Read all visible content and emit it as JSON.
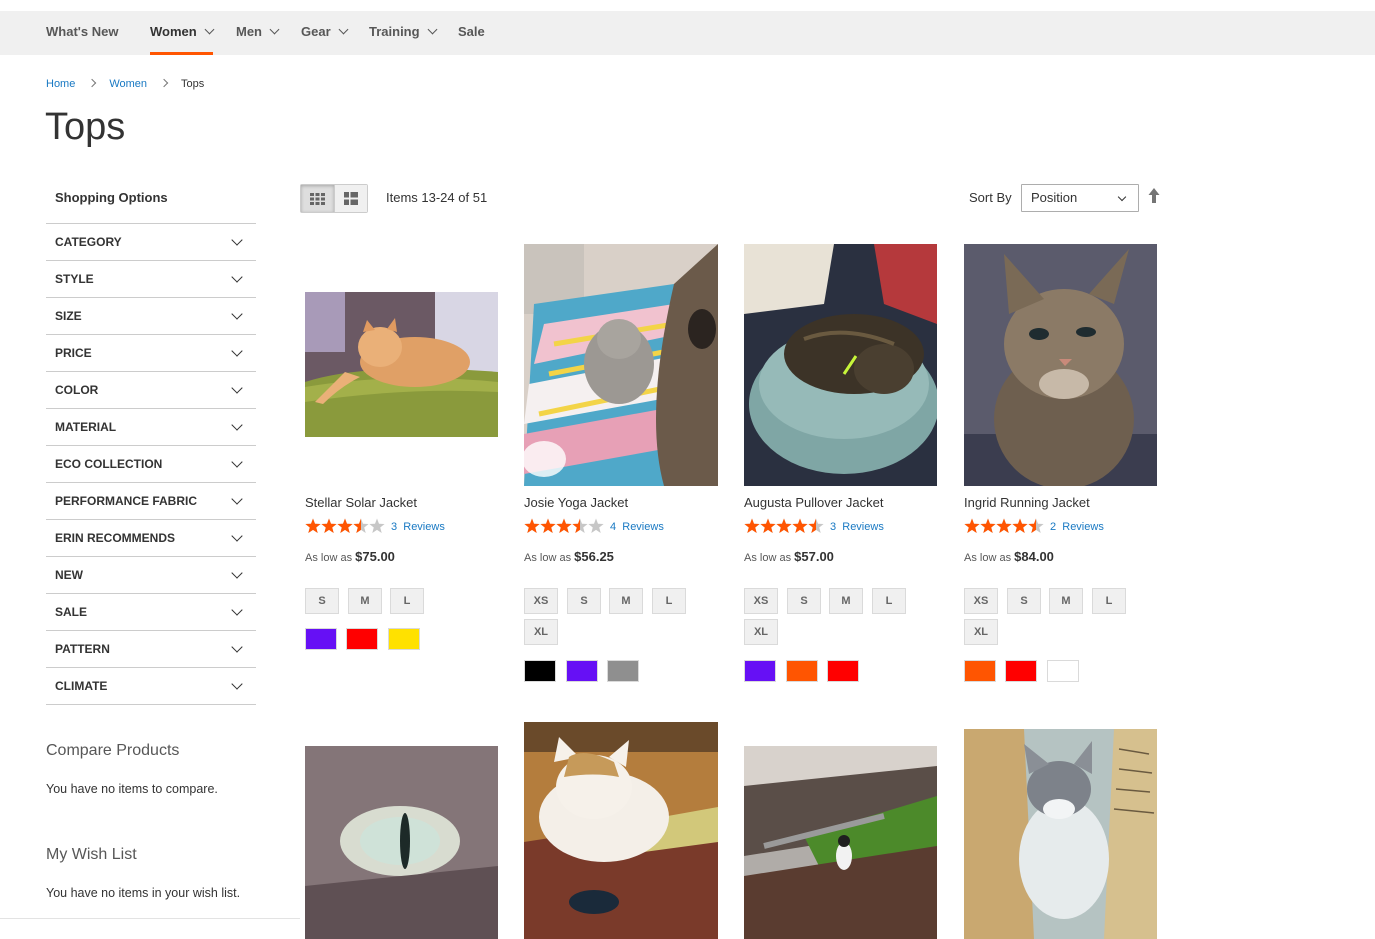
{
  "nav": {
    "items": [
      {
        "label": "What's New",
        "has_menu": false,
        "active": false
      },
      {
        "label": "Women",
        "has_menu": true,
        "active": true
      },
      {
        "label": "Men",
        "has_menu": true,
        "active": false
      },
      {
        "label": "Gear",
        "has_menu": true,
        "active": false
      },
      {
        "label": "Training",
        "has_menu": true,
        "active": false
      },
      {
        "label": "Sale",
        "has_menu": false,
        "active": false
      }
    ],
    "accent_color": "#ff5501"
  },
  "breadcrumb": {
    "home": "Home",
    "women": "Women",
    "current": "Tops"
  },
  "page": {
    "title": "Tops"
  },
  "sidebar": {
    "shopping_options": "Shopping Options",
    "filters": [
      "CATEGORY",
      "STYLE",
      "SIZE",
      "PRICE",
      "COLOR",
      "MATERIAL",
      "ECO COLLECTION",
      "PERFORMANCE FABRIC",
      "ERIN RECOMMENDS",
      "NEW",
      "SALE",
      "PATTERN",
      "CLIMATE"
    ],
    "compare": {
      "title": "Compare Products",
      "empty": "You have no items to compare."
    },
    "wishlist": {
      "title": "My Wish List",
      "empty": "You have no items in your wish list."
    }
  },
  "toolbar": {
    "modes": [
      "grid-icon",
      "list-icon"
    ],
    "active_mode": "grid",
    "amount": "Items 13-24 of 51",
    "sort_label": "Sort By",
    "sort_value": "Position",
    "sort_direction_icon": "arrow-up-icon"
  },
  "products": [
    {
      "name": "Stellar Solar Jacket",
      "rating": 3.5,
      "reviews_count": "3",
      "reviews_label": "Reviews",
      "price_prefix": "As low as",
      "price": "$75.00",
      "sizes": [
        "S",
        "M",
        "L"
      ],
      "colors": [
        "#6610f5",
        "#ff0000",
        "#ffe100"
      ]
    },
    {
      "name": "Josie Yoga Jacket",
      "rating": 3.5,
      "reviews_count": "4",
      "reviews_label": "Reviews",
      "price_prefix": "As low as",
      "price": "$56.25",
      "sizes": [
        "XS",
        "S",
        "M",
        "L",
        "XL"
      ],
      "colors": [
        "#000000",
        "#6610f5",
        "#8f8f8f"
      ]
    },
    {
      "name": "Augusta Pullover Jacket",
      "rating": 4.5,
      "reviews_count": "3",
      "reviews_label": "Reviews",
      "price_prefix": "As low as",
      "price": "$57.00",
      "sizes": [
        "XS",
        "S",
        "M",
        "L",
        "XL"
      ],
      "colors": [
        "#6610f5",
        "#ff5501",
        "#ff0000"
      ]
    },
    {
      "name": "Ingrid Running Jacket",
      "rating": 4.5,
      "reviews_count": "2",
      "reviews_label": "Reviews",
      "price_prefix": "As low as",
      "price": "$84.00",
      "sizes": [
        "XS",
        "S",
        "M",
        "L",
        "XL"
      ],
      "colors": [
        "#ff5501",
        "#ff0000",
        "#ffffff"
      ]
    }
  ],
  "colors": {
    "link": "#1979c3",
    "star": "#ff5501",
    "star_empty": "#c7c7c7",
    "nav_bg": "#f0f0f0"
  }
}
